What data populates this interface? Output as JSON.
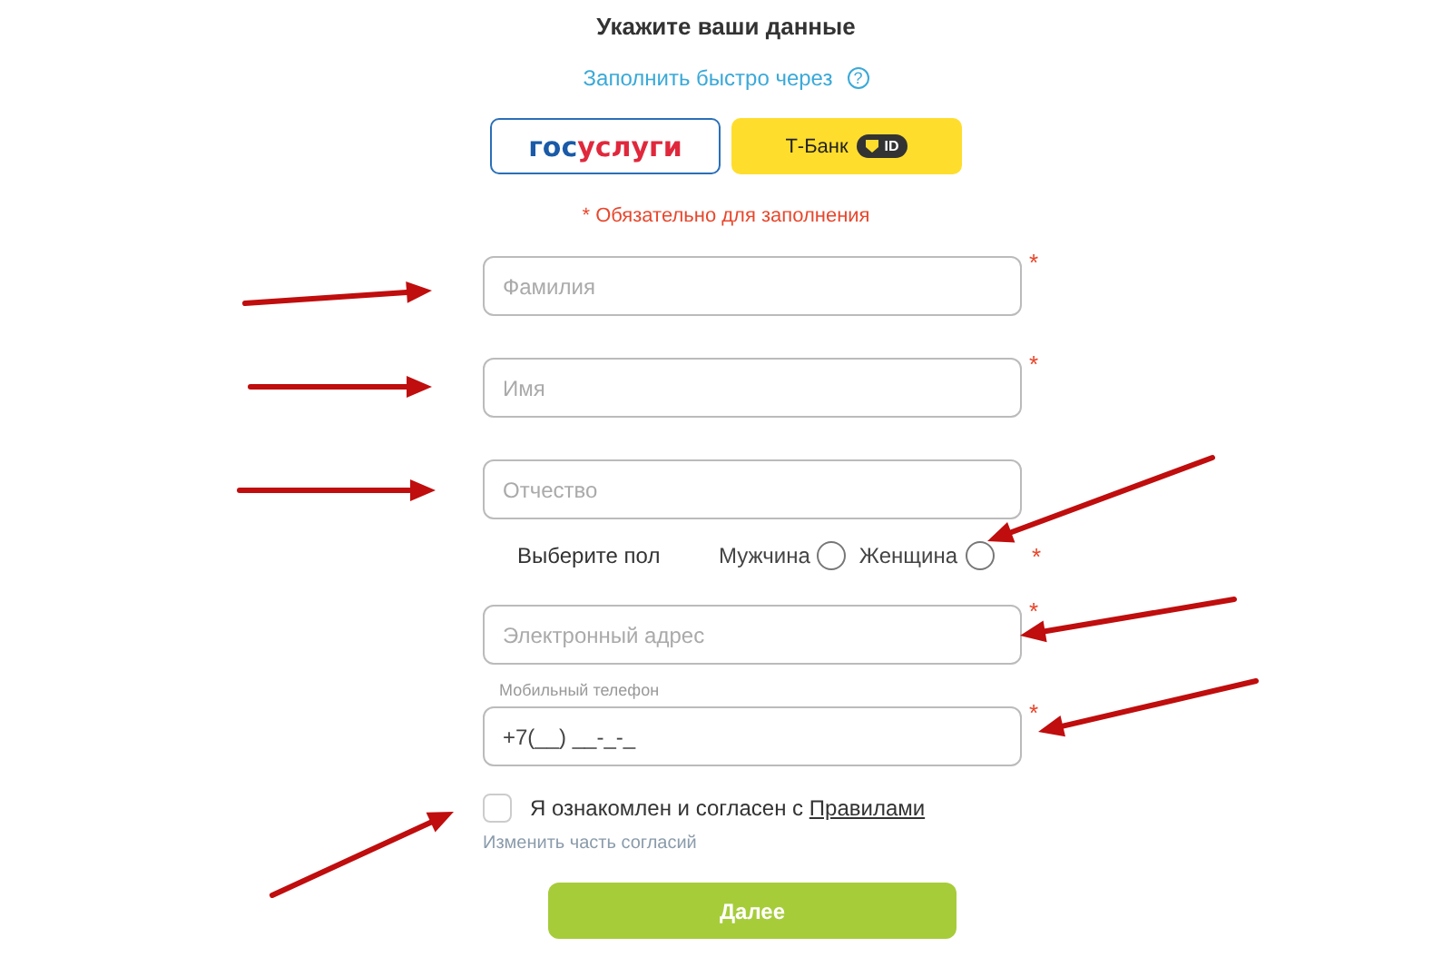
{
  "title": "Укажите ваши данные",
  "quick_fill": {
    "label": "Заполнить быстро через",
    "help": "?"
  },
  "providers": [
    {
      "kind": "gosuslugi",
      "prefix": "гос",
      "suffix": "услуги"
    },
    {
      "kind": "tbank",
      "label": "Т-Банк",
      "badge": "ID"
    }
  ],
  "required_note": "* Обязательно для заполнения",
  "name_fields": [
    {
      "placeholder": "Фамилия",
      "required_mark": "*"
    },
    {
      "placeholder": "Имя",
      "required_mark": "*"
    },
    {
      "placeholder": "Отчество"
    }
  ],
  "gender": {
    "label": "Выберите пол",
    "required_mark": "*",
    "options": [
      {
        "label": "Мужчина",
        "selected": false
      },
      {
        "label": "Женщина",
        "selected": false
      }
    ]
  },
  "email": {
    "placeholder": "Электронный адрес",
    "required_mark": "*"
  },
  "phone": {
    "label": "Мобильный телефон",
    "value": "+7(__) __-_-_",
    "required_mark": "*"
  },
  "consent": {
    "checked": false,
    "text": "Я ознакомлен и согласен с ",
    "link": "Правилами"
  },
  "change_consent": "Изменить часть согласий",
  "submit": "Далее"
}
